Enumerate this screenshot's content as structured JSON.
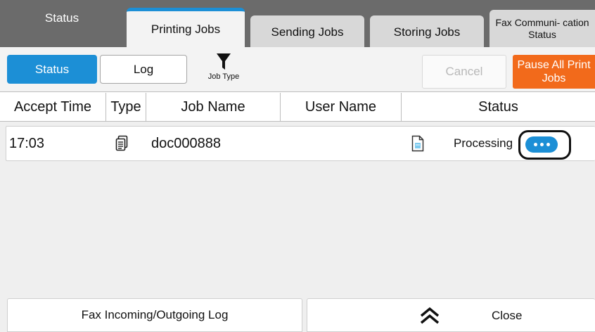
{
  "tabs": {
    "status": "Status",
    "printing_jobs": "Printing Jobs",
    "sending_jobs": "Sending Jobs",
    "storing_jobs": "Storing Jobs",
    "fax_status": "Fax Communi- cation Status"
  },
  "toolbar": {
    "status_label": "Status",
    "log_label": "Log",
    "job_type_label": "Job Type",
    "cancel_label": "Cancel",
    "pause_label": "Pause All Print Jobs"
  },
  "columns": {
    "accept_time": "Accept Time",
    "type": "Type",
    "job_name": "Job Name",
    "user_name": "User Name",
    "status": "Status"
  },
  "jobs": [
    {
      "accept_time": "17:03",
      "type_icon": "copy-icon",
      "job_name": "doc000888",
      "user_name": "",
      "doc_icon": "document-icon",
      "status": "Processing"
    }
  ],
  "footer": {
    "fax_log_label": "Fax Incoming/Outgoing Log",
    "close_label": "Close"
  },
  "colors": {
    "accent_blue": "#1c8fd6",
    "pause_orange": "#f26a1b",
    "header_gray": "#6b6b6b"
  }
}
